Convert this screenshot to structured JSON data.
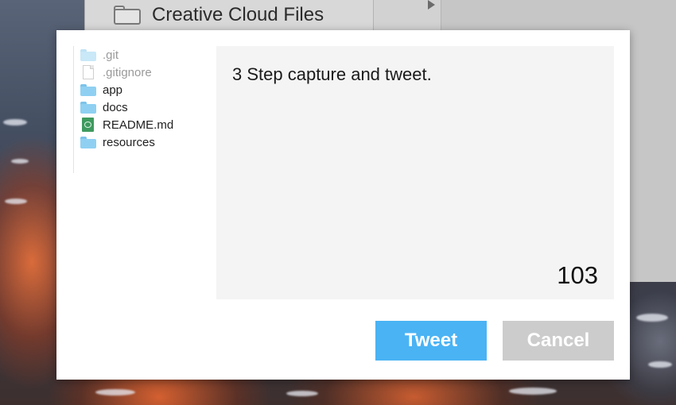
{
  "finder": {
    "sidebar_item_label": "Creative Cloud Files"
  },
  "file_tree": {
    "items": [
      {
        "label": ".git",
        "icon": "folder-icon",
        "muted": true
      },
      {
        "label": ".gitignore",
        "icon": "document-icon",
        "muted": true
      },
      {
        "label": "app",
        "icon": "folder-icon",
        "muted": false
      },
      {
        "label": "docs",
        "icon": "folder-icon",
        "muted": false
      },
      {
        "label": "README.md",
        "icon": "markdown-file-icon",
        "muted": false
      },
      {
        "label": "resources",
        "icon": "folder-icon",
        "muted": false
      }
    ]
  },
  "composer": {
    "text": "3 Step capture and tweet.",
    "remaining_chars": "103"
  },
  "buttons": {
    "tweet_label": "Tweet",
    "cancel_label": "Cancel"
  },
  "colors": {
    "tweet_button": "#4ab3f4",
    "cancel_button": "#cccccc",
    "composer_background": "#f4f4f4",
    "folder_icon": "#8fd0f2",
    "markdown_icon": "#3f9a5f"
  }
}
